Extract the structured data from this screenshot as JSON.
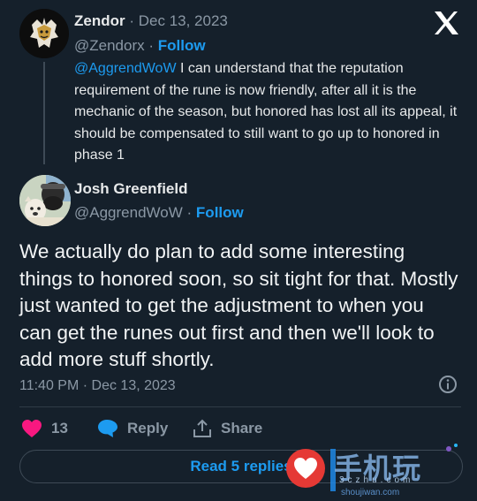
{
  "parent": {
    "name": "Zendor",
    "separator": "·",
    "date": "Dec 13, 2023",
    "handle": "@Zendorx",
    "follow_label": "Follow",
    "mention": "@AggrendWoW",
    "text": " I can understand that the reputation requirement of the rune is now friendly, after all it is the mechanic of the season, but honored has lost all its appeal, it should be compensated to still want to go up to honored in phase 1"
  },
  "main": {
    "name": "Josh Greenfield",
    "handle": "@AggrendWoW",
    "separator": "·",
    "follow_label": "Follow",
    "text": "We actually do plan to add some interesting things to honored soon, so sit tight for that. Mostly just wanted to get the adjustment to when you can get the runes out first and then we'll look to add more stuff shortly.",
    "timestamp": "11:40 PM · Dec 13, 2023"
  },
  "actions": {
    "like_count": "13",
    "reply_label": "Reply",
    "share_label": "Share"
  },
  "replies_button": "Read 5 replies",
  "watermark": {
    "main": "手机玩",
    "sub1": "3czhu.com",
    "sub2": "shoujiwan.com"
  },
  "colors": {
    "background": "#15202b",
    "accent": "#1d9bf0",
    "like": "#f91880",
    "muted": "#8b98a5"
  },
  "icons": [
    "x-logo-icon",
    "info-icon",
    "heart-icon",
    "reply-bubble-icon",
    "share-icon"
  ]
}
